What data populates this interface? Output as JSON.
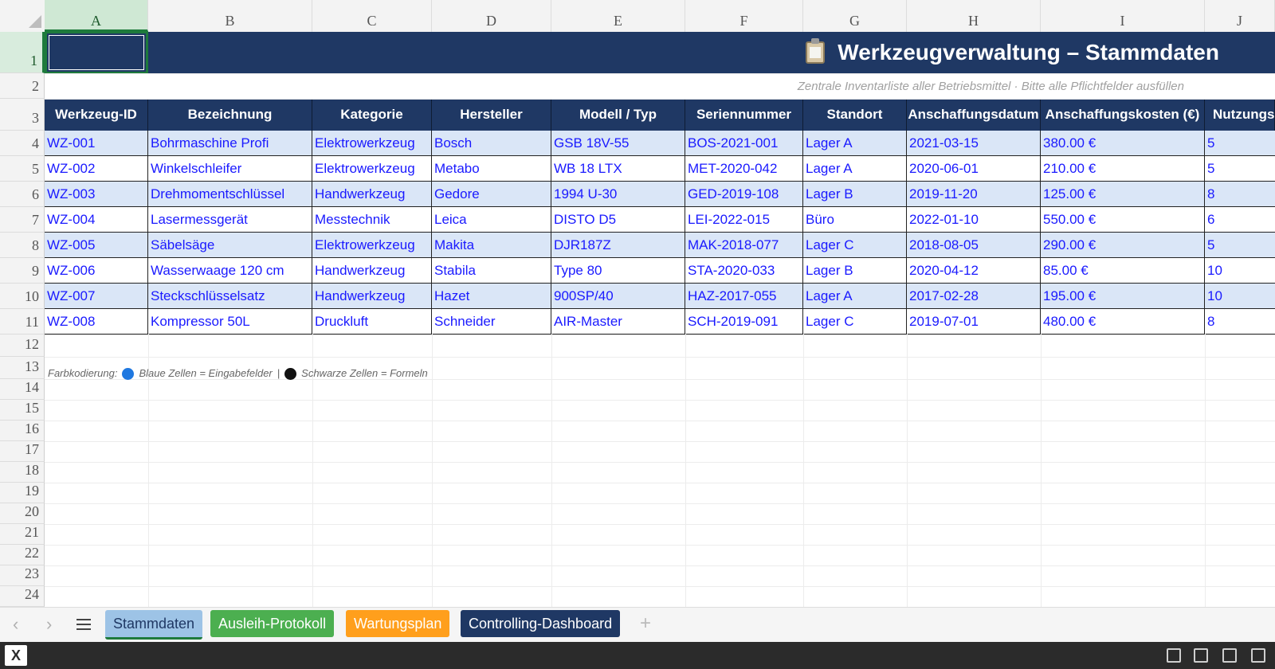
{
  "spreadsheet": {
    "columns": [
      "A",
      "B",
      "C",
      "D",
      "E",
      "F",
      "G",
      "H",
      "I",
      "J"
    ],
    "rows": [
      "1",
      "2",
      "3",
      "4",
      "5",
      "6",
      "7",
      "8",
      "9",
      "10",
      "11",
      "12",
      "13",
      "14",
      "15",
      "16",
      "17",
      "18",
      "19",
      "20",
      "21",
      "22",
      "23",
      "24"
    ],
    "title": "Werkzeugverwaltung – Stammdaten",
    "title_icon": "clipboard-icon",
    "subtitle": "Zentrale Inventarliste aller Betriebsmittel · Bitte alle Pflichtfelder ausfüllen",
    "headers": [
      "Werkzeug-ID",
      "Bezeichnung",
      "Kategorie",
      "Hersteller",
      "Modell / Typ",
      "Seriennummer",
      "Standort",
      "Anschaffungsdatum",
      "Anschaffungskosten (€)",
      "Nutzungs"
    ],
    "data_rows": [
      [
        "WZ-001",
        "Bohrmaschine Profi",
        "Elektrowerkzeug",
        "Bosch",
        "GSB 18V-55",
        "BOS-2021-001",
        "Lager A",
        "2021-03-15",
        "380.00 €",
        "5"
      ],
      [
        "WZ-002",
        "Winkelschleifer",
        "Elektrowerkzeug",
        "Metabo",
        "WB 18 LTX",
        "MET-2020-042",
        "Lager A",
        "2020-06-01",
        "210.00 €",
        "5"
      ],
      [
        "WZ-003",
        "Drehmomentschlüssel",
        "Handwerkzeug",
        "Gedore",
        "1994 U-30",
        "GED-2019-108",
        "Lager B",
        "2019-11-20",
        "125.00 €",
        "8"
      ],
      [
        "WZ-004",
        "Lasermessgerät",
        "Messtechnik",
        "Leica",
        "DISTO D5",
        "LEI-2022-015",
        "Büro",
        "2022-01-10",
        "550.00 €",
        "6"
      ],
      [
        "WZ-005",
        "Säbelsäge",
        "Elektrowerkzeug",
        "Makita",
        "DJR187Z",
        "MAK-2018-077",
        "Lager C",
        "2018-08-05",
        "290.00 €",
        "5"
      ],
      [
        "WZ-006",
        "Wasserwaage 120 cm",
        "Handwerkzeug",
        "Stabila",
        "Type 80",
        "STA-2020-033",
        "Lager B",
        "2020-04-12",
        "85.00 €",
        "10"
      ],
      [
        "WZ-007",
        "Steckschlüsselsatz",
        "Handwerkzeug",
        "Hazet",
        "900SP/40",
        "HAZ-2017-055",
        "Lager A",
        "2017-02-28",
        "195.00 €",
        "10"
      ],
      [
        "WZ-008",
        "Kompressor 50L",
        "Druckluft",
        "Schneider",
        "AIR-Master",
        "SCH-2019-091",
        "Lager C",
        "2019-07-01",
        "480.00 €",
        "8"
      ]
    ],
    "legend": {
      "prefix": "Farbkodierung:",
      "blue_label": "Blaue Zellen = Eingabefelder",
      "separator": "|",
      "black_label": "Schwarze Zellen = Formeln"
    },
    "active_cell": "A1"
  },
  "tabs": [
    {
      "label": "Stammdaten",
      "bg": "#9dc3e6",
      "color": "#1f3864",
      "active": true
    },
    {
      "label": "Ausleih-Protokoll",
      "bg": "#4caf50",
      "color": "#ffffff",
      "active": false
    },
    {
      "label": "Wartungsplan",
      "bg": "#ff9f1c",
      "color": "#ffffff",
      "active": false
    },
    {
      "label": "Controlling-Dashboard",
      "bg": "#1f3864",
      "color": "#ffffff",
      "active": false
    }
  ],
  "tabbar": {
    "prev": "‹",
    "next": "›",
    "add": "+"
  },
  "statusbar": {
    "app_icon": "X"
  },
  "colors": {
    "header_navy": "#1f3864",
    "input_blue": "#1a1aff",
    "shade": "#dae6f7",
    "selection": "#1e7a3c"
  }
}
